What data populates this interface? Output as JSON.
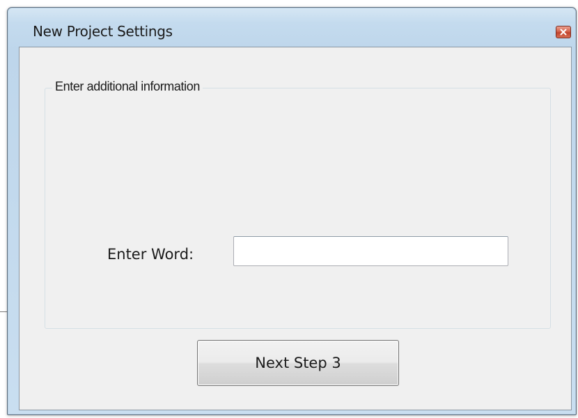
{
  "window": {
    "title": "New Project Settings",
    "close_icon": "close-icon"
  },
  "group": {
    "legend": "Enter additional information"
  },
  "form": {
    "word_label": "Enter Word:",
    "word_value": "",
    "word_placeholder": ""
  },
  "actions": {
    "next_label": "Next Step 3"
  },
  "colors": {
    "titlebar": "#c4dbee",
    "client_background": "#f0f0f0",
    "close_button": "#c0432c"
  }
}
